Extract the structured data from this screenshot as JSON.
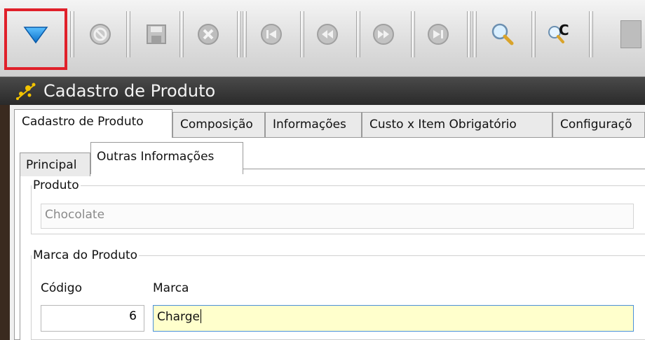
{
  "toolbar": {
    "buttons": [
      {
        "icon": "filter-icon"
      },
      {
        "icon": "cancel-icon"
      },
      {
        "icon": "save-icon"
      },
      {
        "icon": "delete-icon"
      },
      {
        "icon": "first-record-icon"
      },
      {
        "icon": "previous-record-icon"
      },
      {
        "icon": "next-record-icon"
      },
      {
        "icon": "last-record-icon"
      },
      {
        "icon": "search-icon"
      },
      {
        "icon": "search-code-icon"
      }
    ],
    "search_code_glyph": "C"
  },
  "window": {
    "title": "Cadastro de Produto"
  },
  "main_tabs": [
    {
      "label": "Cadastro de Produto",
      "active": true
    },
    {
      "label": "Composição"
    },
    {
      "label": "Informações"
    },
    {
      "label": "Custo x Item Obrigatório"
    },
    {
      "label": "Configuraçõ"
    }
  ],
  "sub_tabs": [
    {
      "label": "Principal"
    },
    {
      "label": "Outras Informações",
      "active": true
    }
  ],
  "produto": {
    "legend": "Produto",
    "value": "Chocolate"
  },
  "marca": {
    "legend": "Marca do Produto",
    "codigo_label": "Código",
    "codigo_value": "6",
    "marca_label": "Marca",
    "marca_value": "Charge"
  },
  "colors": {
    "highlight": "#e0202a",
    "focused_field": "#ffffcc",
    "filter_icon": "#1e8ce0"
  }
}
